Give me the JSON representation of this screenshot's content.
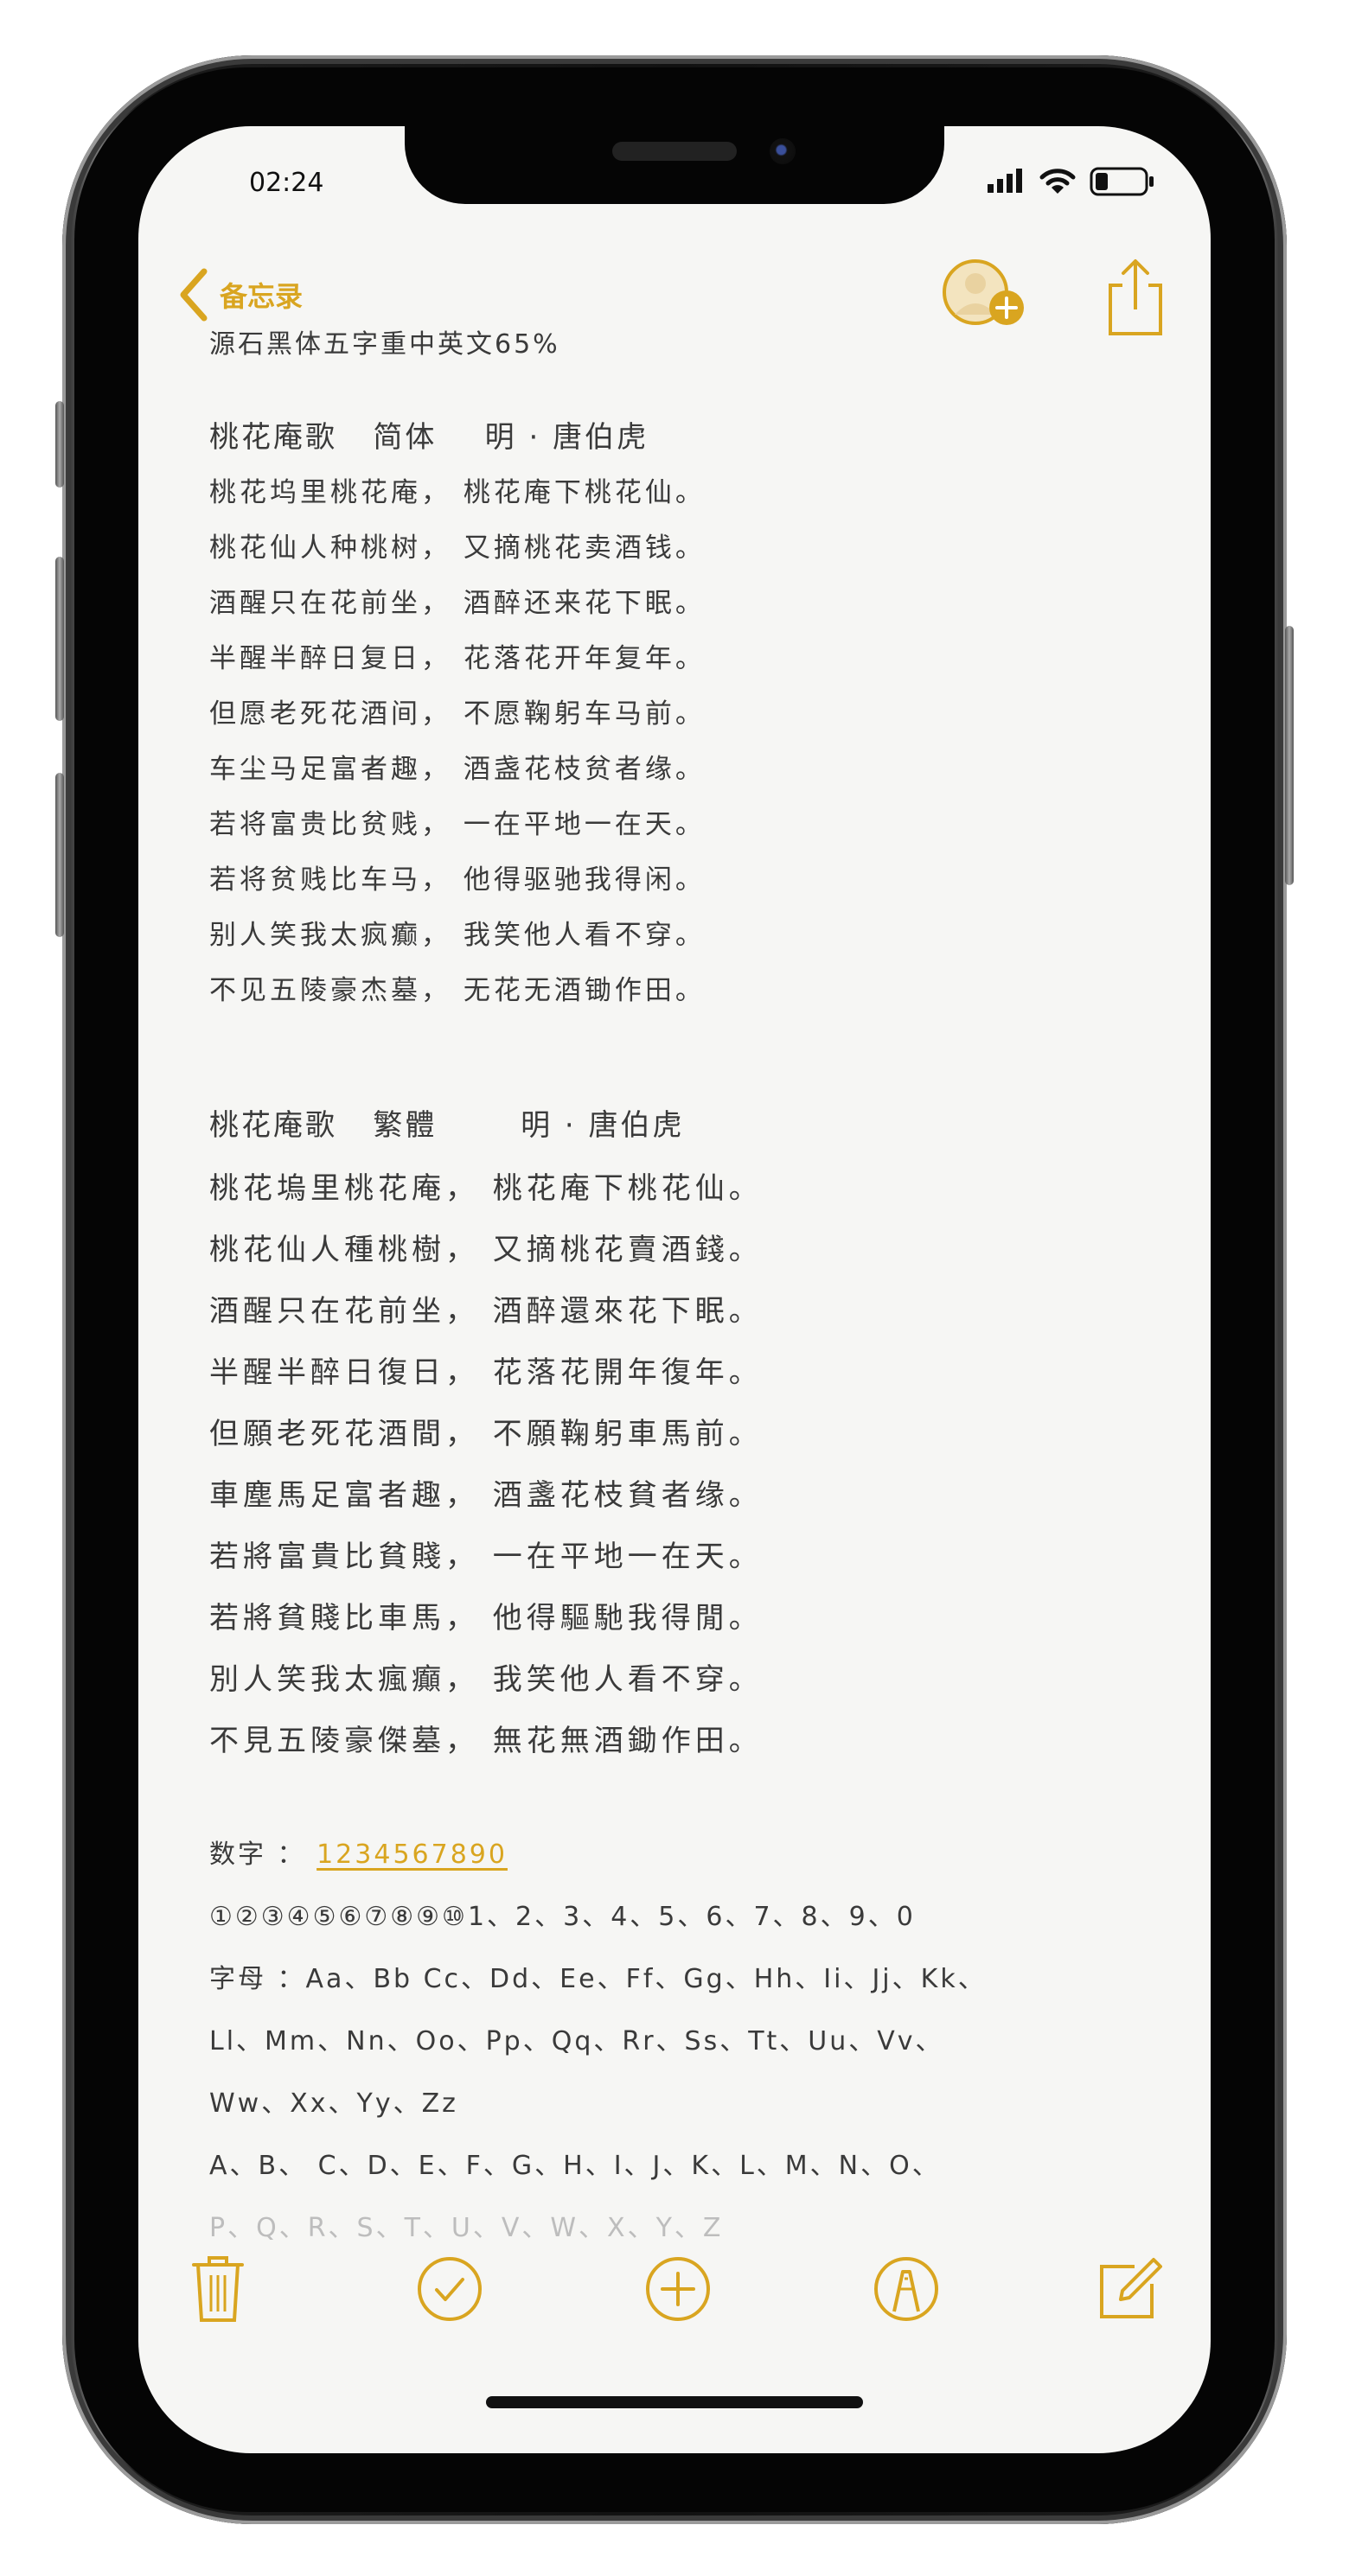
{
  "status_bar": {
    "time": "02:24"
  },
  "nav": {
    "back_label": "备忘录"
  },
  "note": {
    "subtitle": "源石黑体五字重中英文65%",
    "section1": {
      "heading": "桃花庵歌   简体    明 · 唐伯虎",
      "lines": [
        "桃花坞里桃花庵， 桃花庵下桃花仙。",
        "桃花仙人种桃树， 又摘桃花卖酒钱。",
        "酒醒只在花前坐， 酒醉还来花下眠。",
        "半醒半醉日复日， 花落花开年复年。",
        "但愿老死花酒间， 不愿鞠躬车马前。",
        "车尘马足富者趣， 酒盏花枝贫者缘。",
        "若将富贵比贫贱， 一在平地一在天。",
        "若将贫贱比车马， 他得驱驰我得闲。",
        "别人笑我太疯癫， 我笑他人看不穿。",
        "不见五陵豪杰墓， 无花无酒锄作田。"
      ]
    },
    "section2": {
      "heading": "桃花庵歌   繁體       明 · 唐伯虎",
      "lines": [
        "桃花塢里桃花庵， 桃花庵下桃花仙。",
        "桃花仙人種桃樹， 又摘桃花賣酒錢。",
        "酒醒只在花前坐， 酒醉還來花下眠。",
        "半醒半醉日復日， 花落花開年復年。",
        "但願老死花酒間， 不願鞠躬車馬前。",
        "車塵馬足富者趣， 酒盞花枝貧者缘。",
        "若將富貴比貧賤， 一在平地一在天。",
        "若將貧賤比車馬， 他得驅馳我得閒。",
        "別人笑我太瘋癲， 我笑他人看不穿。",
        "不見五陵豪傑墓， 無花無酒鋤作田。"
      ]
    },
    "digits_label": "数字 ：",
    "digits_link": "1234567890",
    "digits_line": "①②③④⑤⑥⑦⑧⑨⑩1、2、3、4、5、6、7、8、9、0",
    "letters_line1": "字母 ：Aa、Bb Cc、Dd、Ee、Ff、Gg、Hh、Ii、Jj、Kk、",
    "letters_line2": "Ll、Mm、Nn、Oo、Pp、Qq、Rr、Ss、Tt、Uu、Vv、",
    "letters_line3": "Ww、Xx、Yy、Zz",
    "letters_line4": "A、B、 C、D、E、F、G、H、I、J、K、L、M、N、O、",
    "letters_line5": "P、Q、R、S、T、U、V、W、X、Y、Z"
  },
  "colors": {
    "accent": "#d9a520",
    "text": "#3a3a3a",
    "background": "#f6f6f4"
  },
  "icons": {
    "back": "chevron-left-icon",
    "avatar": "add-person-icon",
    "share": "share-icon",
    "trash": "trash-icon",
    "checklist": "checkmark-circle-icon",
    "add": "plus-circle-icon",
    "markup": "pen-circle-icon",
    "compose": "compose-icon"
  }
}
